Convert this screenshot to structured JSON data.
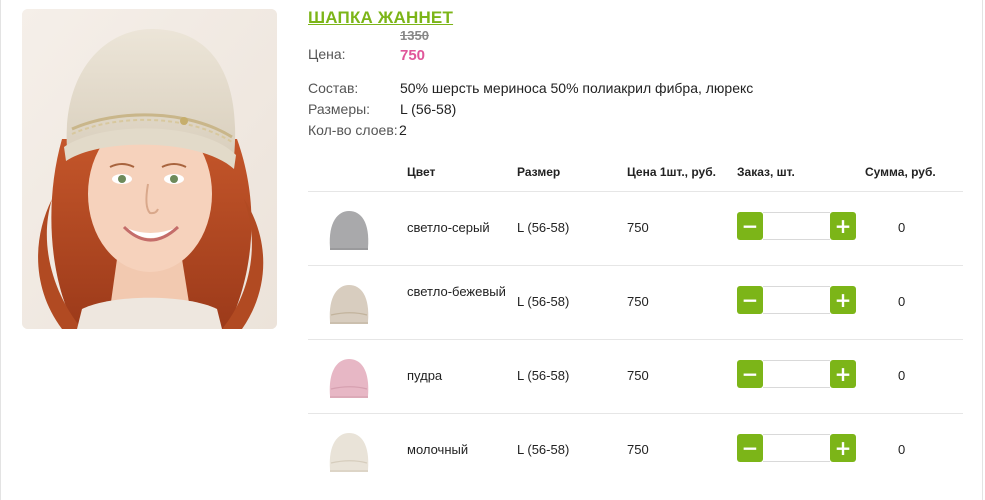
{
  "product": {
    "title": "ШАПКА ЖАННЕТ",
    "price_label": "Цена:",
    "old_price": "1350",
    "new_price": "750",
    "composition_label": "Состав:",
    "composition_value": "50% шерсть мериноса 50% полиакрил фибра, люрекс",
    "sizes_label": "Размеры:",
    "sizes_value": "L (56-58)",
    "layers_label": "Кол-во слоев:",
    "layers_value": "2"
  },
  "table": {
    "headers": {
      "color": "Цвет",
      "size": "Размер",
      "price": "Цена 1шт., руб.",
      "order": "Заказ, шт.",
      "sum": "Сумма, руб."
    },
    "rows": [
      {
        "color_name": "светло-серый",
        "size": "L (56-58)",
        "price": "750",
        "qty": "",
        "sum": "0",
        "swatch": "#a9a9ab"
      },
      {
        "color_name": "светло-бежевый",
        "size": "L (56-58)",
        "price": "750",
        "qty": "",
        "sum": "0",
        "swatch": "#d8cdbf"
      },
      {
        "color_name": "пудра",
        "size": "L (56-58)",
        "price": "750",
        "qty": "",
        "sum": "0",
        "swatch": "#e7b7c5"
      },
      {
        "color_name": "молочный",
        "size": "L (56-58)",
        "price": "750",
        "qty": "",
        "sum": "0",
        "swatch": "#e9e3d8"
      }
    ],
    "minus_symbol": "−",
    "plus_symbol": "+"
  },
  "colors": {
    "accent_green": "#7cb518",
    "price_pink": "#e0569a"
  }
}
